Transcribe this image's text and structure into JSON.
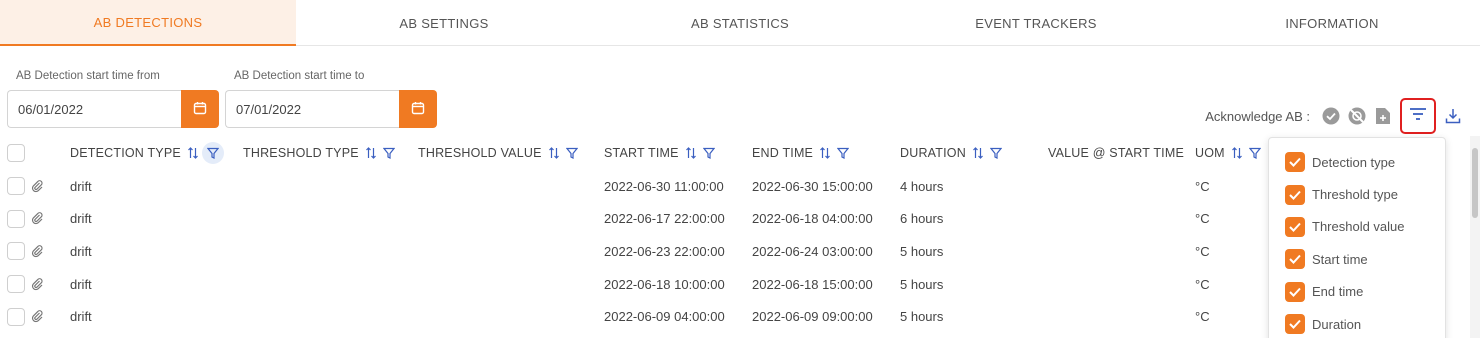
{
  "tabs": [
    {
      "label": "AB DETECTIONS",
      "active": true
    },
    {
      "label": "AB SETTINGS",
      "active": false
    },
    {
      "label": "AB STATISTICS",
      "active": false
    },
    {
      "label": "EVENT TRACKERS",
      "active": false
    },
    {
      "label": "INFORMATION",
      "active": false
    }
  ],
  "filters": {
    "from": {
      "label": "AB Detection start time from",
      "value": "06/01/2022"
    },
    "to": {
      "label": "AB Detection start time to",
      "value": "07/01/2022"
    }
  },
  "toolbar": {
    "acknowledge_label": "Acknowledge AB :"
  },
  "table": {
    "columns": {
      "detection_type": "DETECTION TYPE",
      "threshold_type": "THRESHOLD TYPE",
      "threshold_value": "THRESHOLD VALUE",
      "start_time": "START TIME",
      "end_time": "END TIME",
      "duration": "DURATION",
      "value_at_start": "VALUE @ START TIME",
      "uom": "UOM"
    },
    "rows": [
      {
        "type": "drift",
        "start": "2022-06-30 11:00:00",
        "end": "2022-06-30 15:00:00",
        "duration": "4 hours",
        "uom": "°C"
      },
      {
        "type": "drift",
        "start": "2022-06-17 22:00:00",
        "end": "2022-06-18 04:00:00",
        "duration": "6 hours",
        "uom": "°C"
      },
      {
        "type": "drift",
        "start": "2022-06-23 22:00:00",
        "end": "2022-06-24 03:00:00",
        "duration": "5 hours",
        "uom": "°C"
      },
      {
        "type": "drift",
        "start": "2022-06-18 10:00:00",
        "end": "2022-06-18 15:00:00",
        "duration": "5 hours",
        "uom": "°C"
      },
      {
        "type": "drift",
        "start": "2022-06-09 04:00:00",
        "end": "2022-06-09 09:00:00",
        "duration": "5 hours",
        "uom": "°C"
      }
    ]
  },
  "column_chooser": {
    "options": [
      {
        "label": "Detection type",
        "checked": true
      },
      {
        "label": "Threshold type",
        "checked": true
      },
      {
        "label": "Threshold value",
        "checked": true
      },
      {
        "label": "Start time",
        "checked": true
      },
      {
        "label": "End time",
        "checked": true
      },
      {
        "label": "Duration",
        "checked": true
      }
    ]
  },
  "colors": {
    "accent": "#f07a22",
    "highlight": "#e02020",
    "filter_active_bg": "#e4ecf9"
  },
  "icons": [
    "calendar-icon",
    "check-circle-icon",
    "no-alert-icon",
    "add-document-icon",
    "filter-lines-icon",
    "download-icon",
    "paperclip-icon",
    "sort-icon",
    "funnel-icon",
    "checkmark-icon"
  ]
}
